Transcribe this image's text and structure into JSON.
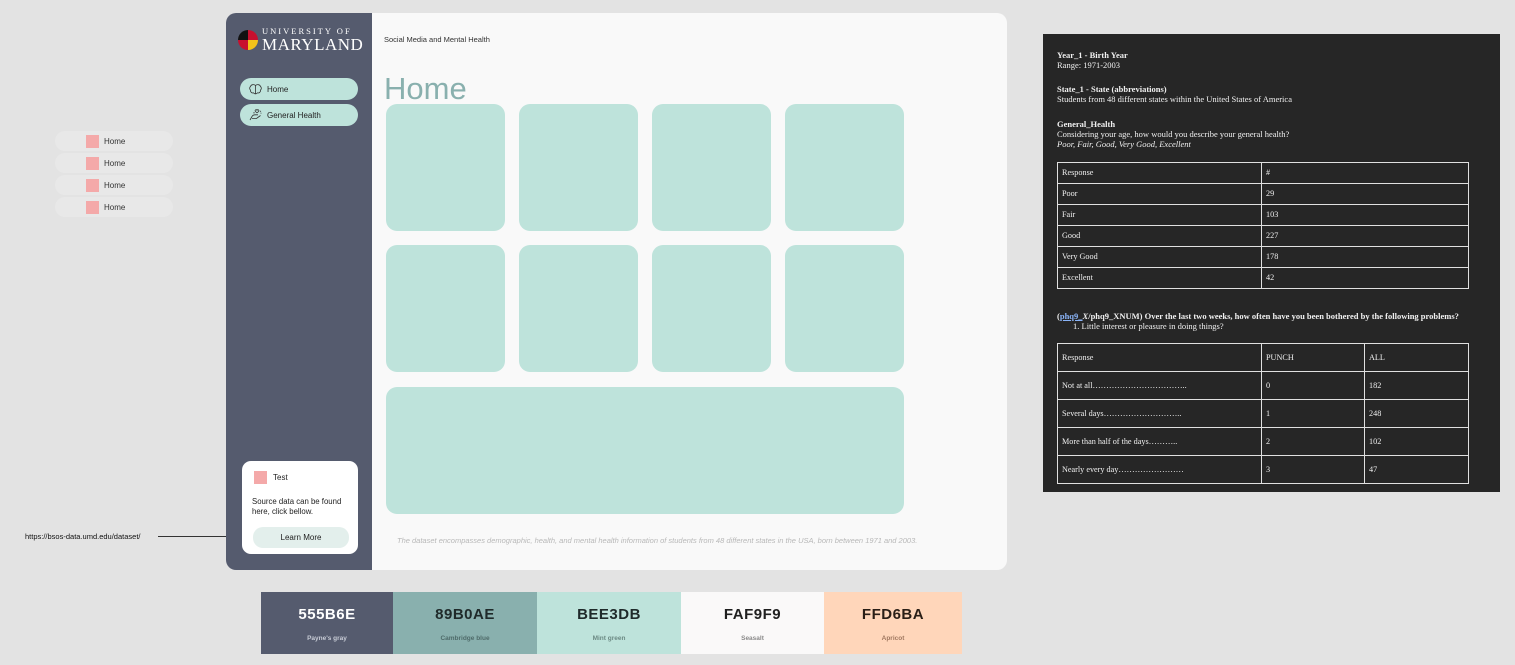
{
  "components": {
    "nav_items": [
      "Home",
      "Home",
      "Home",
      "Home"
    ],
    "url_note": "https://bsos-data.umd.edu/dataset/"
  },
  "app": {
    "logo": {
      "line1": "UNIVERSITY OF",
      "line2": "MARYLAND"
    },
    "breadcrumb": "Social Media and Mental Health",
    "page_title": "Home",
    "nav": [
      {
        "label": "Home",
        "icon": "brain-icon"
      },
      {
        "label": "General Health",
        "icon": "hand-heart-icon"
      }
    ],
    "card": {
      "label": "Test",
      "text": "Source data can be found here, click bellow.",
      "button": "Learn More"
    },
    "footer": "The dataset encompasses demographic, health, and mental health information of students from 48 different states in the USA, born between 1971 and 2003."
  },
  "palette": [
    {
      "hex": "555B6E",
      "name": "Payne's gray",
      "color": "#555b6e",
      "text_color": "#ffffff",
      "name_color": "#c8ccd6"
    },
    {
      "hex": "89B0AE",
      "name": "Cambridge blue",
      "color": "#89b0ae",
      "text_color": "#1f2a2a",
      "name_color": "#4f6b6a"
    },
    {
      "hex": "BEE3DB",
      "name": "Mint green",
      "color": "#bee3db",
      "text_color": "#1f2a2a",
      "name_color": "#6c8a84"
    },
    {
      "hex": "FAF9F9",
      "name": "Seasalt",
      "color": "#faf9f9",
      "text_color": "#1f1f1f",
      "name_color": "#8a8a8a"
    },
    {
      "hex": "FFD6BA",
      "name": "Apricot",
      "color": "#ffd6ba",
      "text_color": "#2a1e16",
      "name_color": "#a07860"
    }
  ],
  "doc": {
    "year_title": "Year_1 - Birth Year",
    "year_range": "Range: 1971-2003",
    "state_title": "State_1 - State (abbreviations)",
    "state_desc": "Students from 48 different states within the United States of America",
    "gh_title": "General_Health",
    "gh_question": "Considering your age, how would you describe your general health?",
    "gh_options": "Poor, Fair, Good, Very Good, Excellent",
    "gh_table": {
      "headers": [
        "Response",
        "#"
      ],
      "rows": [
        [
          "Poor",
          "29"
        ],
        [
          "Fair",
          "103"
        ],
        [
          "Good",
          "227"
        ],
        [
          "Very Good",
          "178"
        ],
        [
          "Excellent",
          "42"
        ]
      ]
    },
    "phq_link": "phq9_",
    "phq_x": "X",
    "phq_title_rest": "/phq9_XNUM) Over the last two weeks, how often have you been bothered by the following problems?",
    "phq_item": "1.   Little interest or pleasure in doing things?",
    "phq_table": {
      "headers": [
        "Response",
        "PUNCH",
        "ALL"
      ],
      "rows": [
        [
          "Not at all……………………………..",
          "0",
          "182"
        ],
        [
          "Several days………………………..",
          "1",
          "248"
        ],
        [
          "More than half of the days………..",
          "2",
          "102"
        ],
        [
          "Nearly every day……………………",
          "3",
          "47"
        ]
      ]
    }
  }
}
